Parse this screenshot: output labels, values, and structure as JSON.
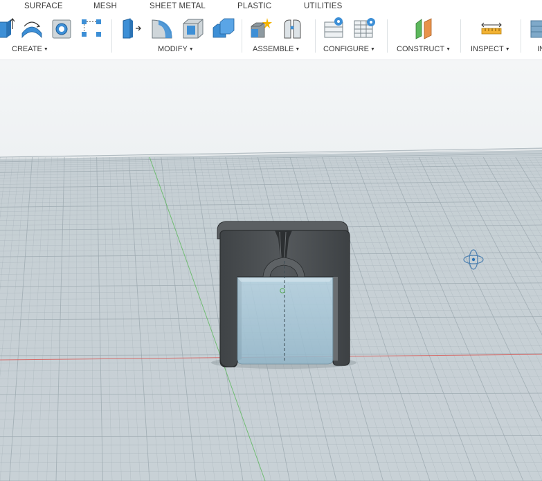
{
  "tabs": [
    {
      "label": "SURFACE"
    },
    {
      "label": "MESH"
    },
    {
      "label": "SHEET METAL"
    },
    {
      "label": "PLASTIC"
    },
    {
      "label": "UTILITIES"
    }
  ],
  "groups": {
    "create": "CREATE",
    "modify": "MODIFY",
    "assemble": "ASSEMBLE",
    "configure": "CONFIGURE",
    "construct": "CONSTRUCT",
    "inspect": "INSPECT",
    "insert_partial": "IN"
  },
  "icons": [
    "extrude-icon",
    "revolve-icon",
    "hole-icon",
    "sketch-pattern-icon",
    "press-pull-icon",
    "fillet-icon",
    "shell-icon",
    "combine-icon",
    "new-component-icon",
    "joint-icon",
    "configure-table-icon",
    "configure-rules-icon",
    "offset-plane-icon",
    "measure-icon",
    "insert-icon"
  ],
  "colors": {
    "toolbar_bg": "#ffffff",
    "icon_blue": "#3d8fd6",
    "grid_line": "#9aa7ae",
    "x_axis": "#d9534f",
    "y_axis": "#5cb85c",
    "part_body": "#474b4e",
    "part_translucent": "#9fc4d8"
  }
}
